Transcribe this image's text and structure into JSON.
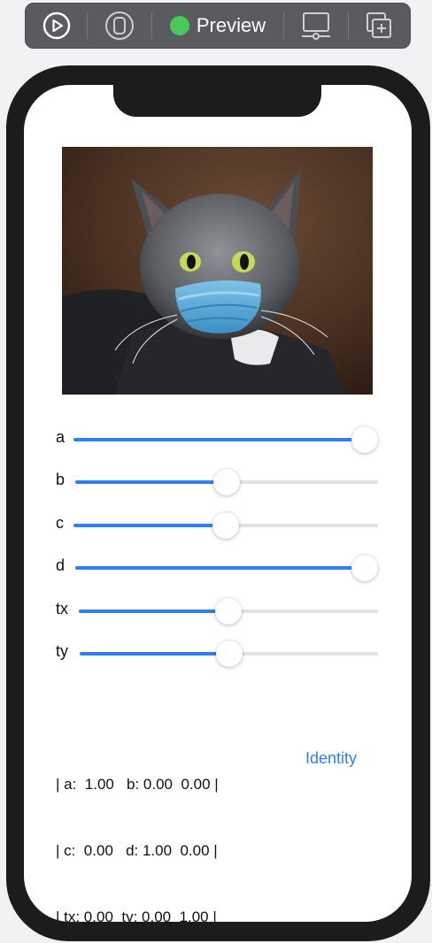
{
  "toolbar": {
    "preview_label": "Preview",
    "status_color": "#49c95b"
  },
  "sliders": [
    {
      "label": "a",
      "value": 1.0
    },
    {
      "label": "b",
      "value": 0.5
    },
    {
      "label": "c",
      "value": 0.5
    },
    {
      "label": "d",
      "value": 1.0
    },
    {
      "label": "tx",
      "value": 0.5
    },
    {
      "label": "ty",
      "value": 0.5
    }
  ],
  "matrix": {
    "row1": "| a:  1.00   b: 0.00  0.00 |",
    "row2": "| c:  0.00   d: 1.00  0.00 |",
    "row3": "| tx: 0.00  ty: 0.00  1.00 |"
  },
  "identity_label": "Identity",
  "colors": {
    "accent": "#2f7ff0",
    "track": "#e2e2e4"
  }
}
